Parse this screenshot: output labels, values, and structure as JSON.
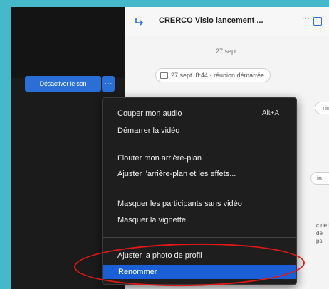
{
  "toolbar": {
    "unmute_label": "Désactiver le son",
    "more_label": "···"
  },
  "chat": {
    "title": "CRERCO   Visio lancement ...",
    "header_more": "···",
    "date": "27 sept.",
    "meeting_chip": "27 sept. 8:44 - réunion démarrée",
    "rin_chip": "rin",
    "in_chip": "in",
    "side_text": "c de la\nde\nps"
  },
  "menu": {
    "items": [
      {
        "label": "Couper mon audio",
        "shortcut": "Alt+A"
      },
      {
        "label": "Démarrer la vidéo",
        "shortcut": ""
      },
      {
        "label": "Flouter mon arrière-plan",
        "shortcut": ""
      },
      {
        "label": "Ajuster l'arrière-plan et les effets...",
        "shortcut": ""
      },
      {
        "label": "Masquer les participants sans vidéo",
        "shortcut": ""
      },
      {
        "label": "Masquer la vignette",
        "shortcut": ""
      },
      {
        "label": "Ajuster la photo de profil",
        "shortcut": ""
      },
      {
        "label": "Renommer",
        "shortcut": "",
        "selected": true
      }
    ]
  },
  "colors": {
    "background": "#45b9c9",
    "accent": "#2a6fd6",
    "menu_bg": "#1e1e1e",
    "menu_selected": "#1b5fd6",
    "annotation": "#e01818"
  }
}
